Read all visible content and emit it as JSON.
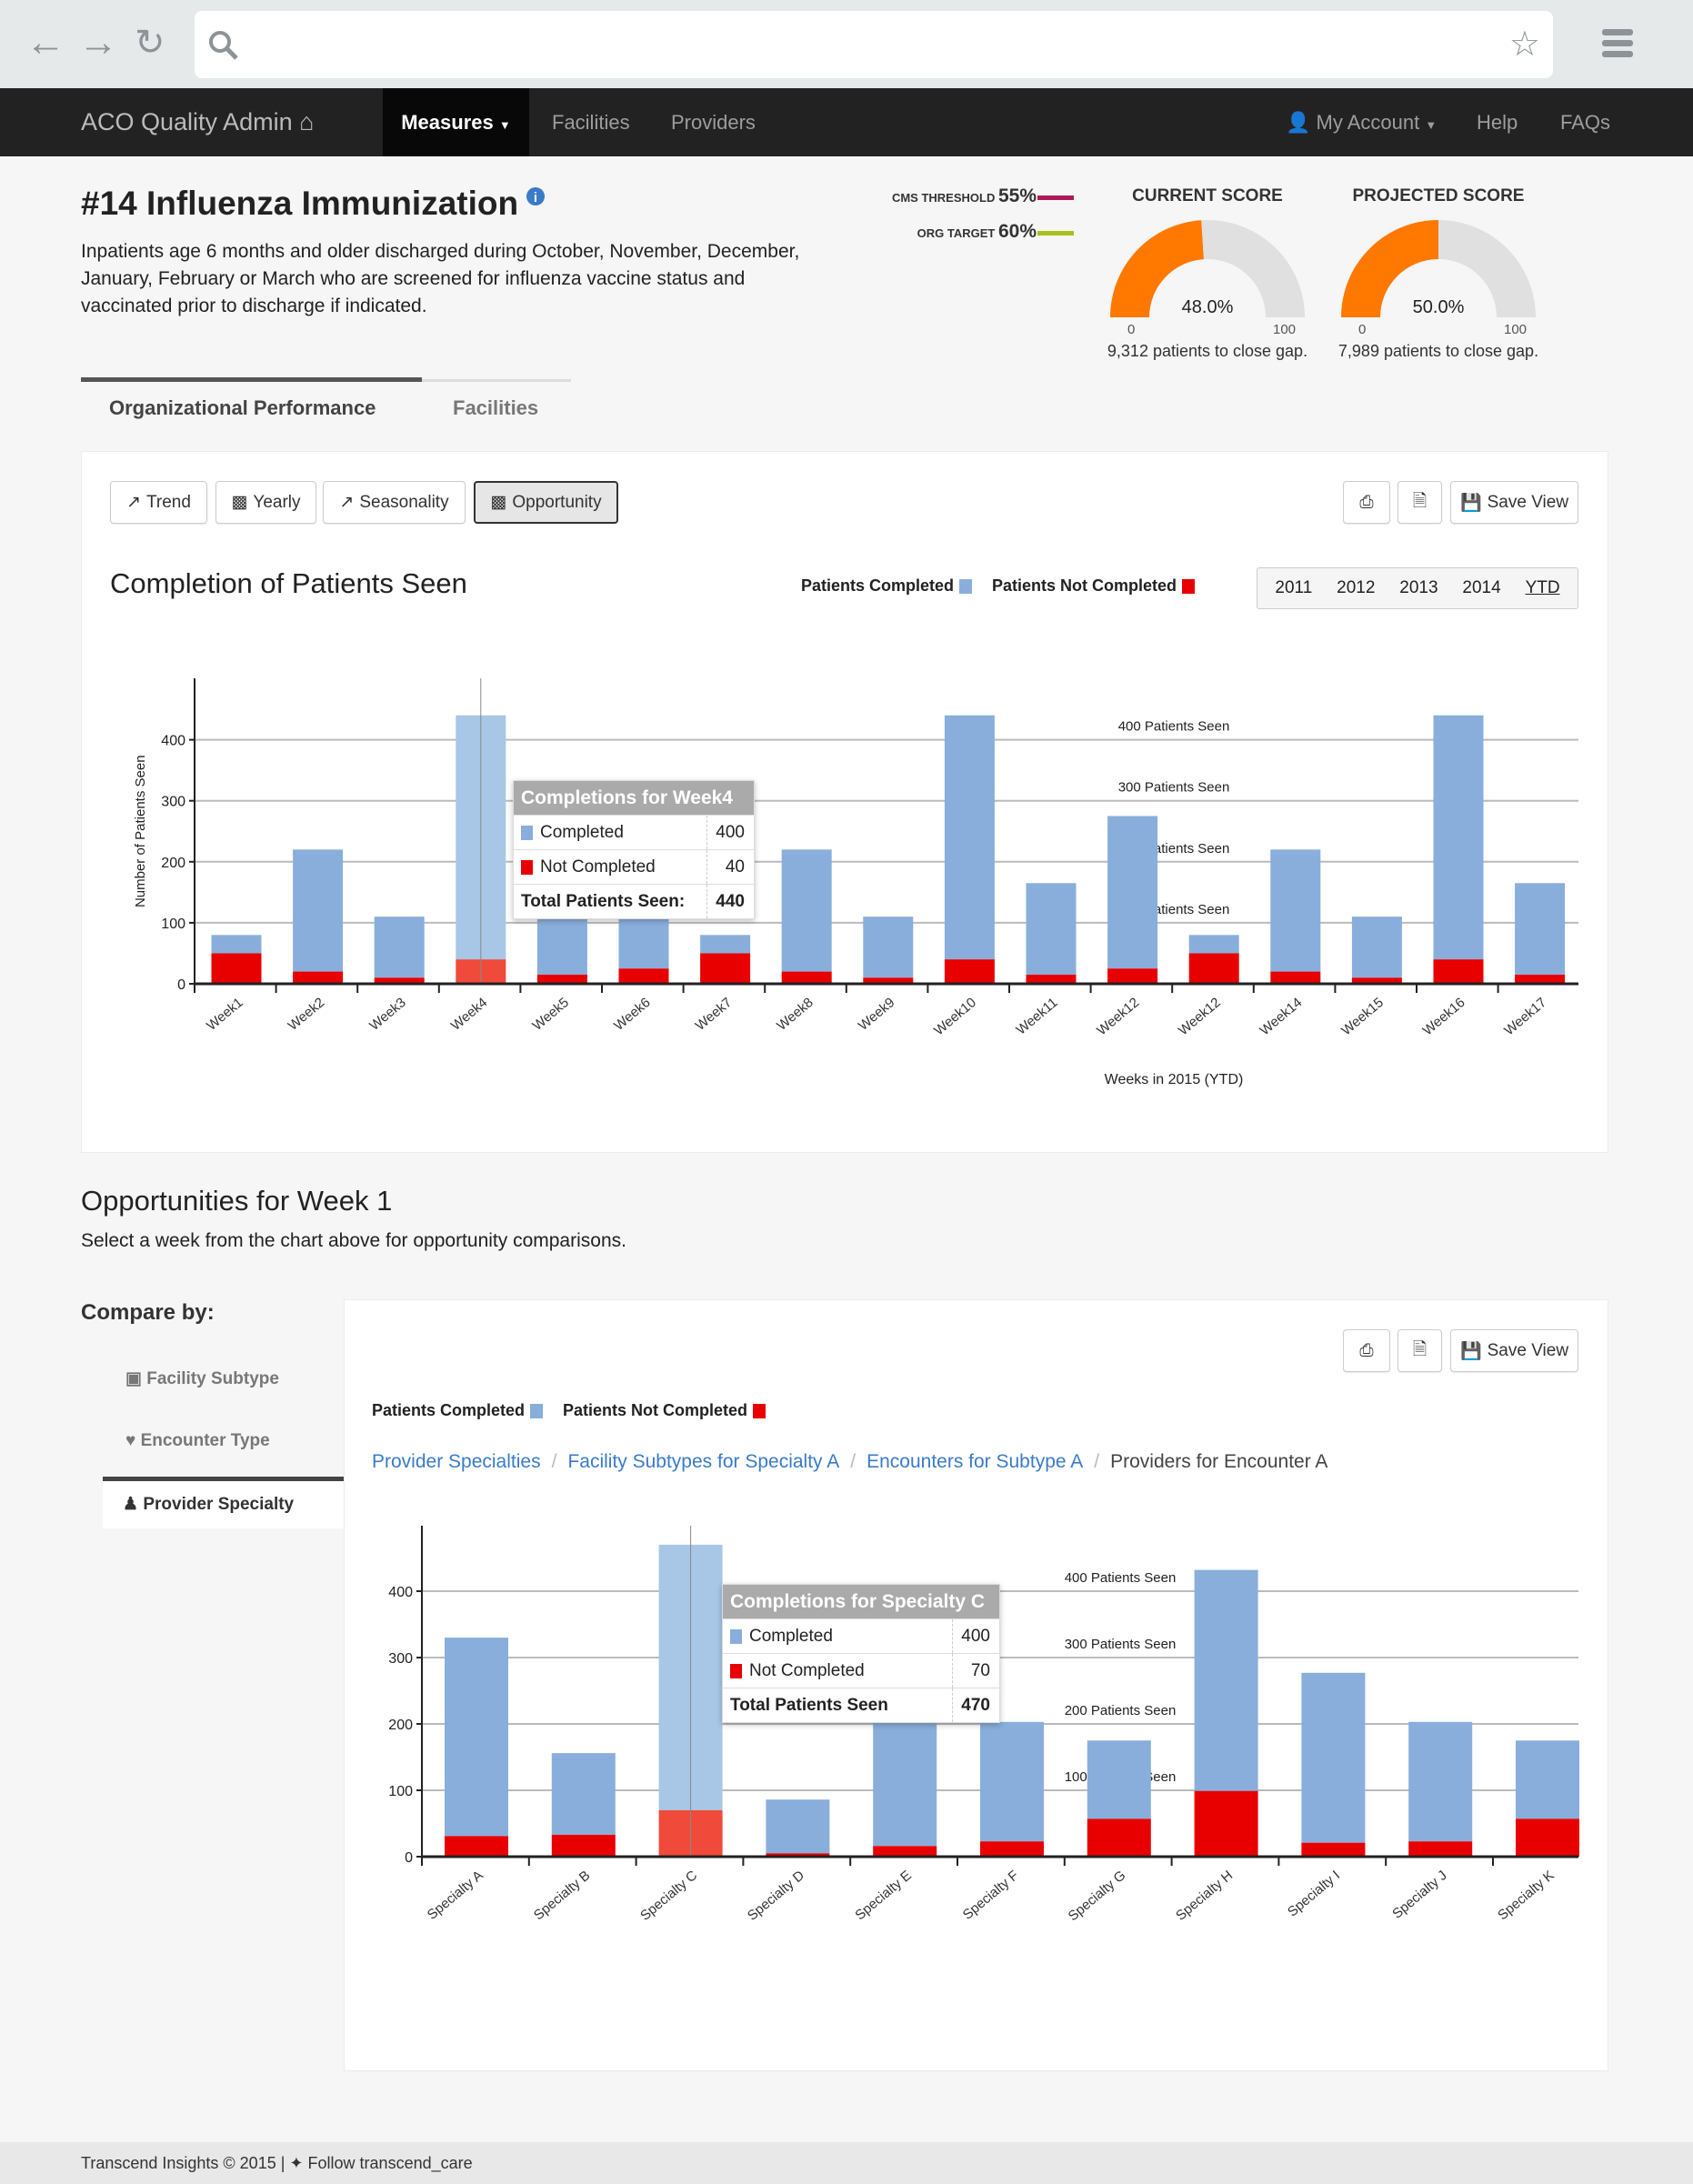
{
  "browser": {
    "url": "",
    "icons": [
      "back-arrow-icon",
      "forward-arrow-icon",
      "reload-icon",
      "search-icon",
      "star-icon",
      "menu-icon"
    ]
  },
  "navbar": {
    "brand": "ACO Quality Admin",
    "items": [
      {
        "label": "Measures",
        "active": true
      },
      {
        "label": "Facilities"
      },
      {
        "label": "Providers"
      }
    ],
    "right_items": [
      {
        "label": "My Account"
      },
      {
        "label": "Help"
      },
      {
        "label": "FAQs"
      }
    ]
  },
  "measure": {
    "title": "#14 Influenza Immunization",
    "description": "Inpatients age 6 months and older discharged during October, November, December, January, February or March who are screened for influenza vaccine status and vaccinated prior to discharge if indicated."
  },
  "thresholds": [
    {
      "label": "CMS THRESHOLD",
      "value": "55%",
      "color": "#b0185a"
    },
    {
      "label": "ORG TARGET",
      "value": "60%",
      "color": "#a9c21b"
    }
  ],
  "scores": [
    {
      "label": "CURRENT SCORE",
      "value": 48.0,
      "display": "48.0%",
      "min": "0",
      "max": "100",
      "gap_text": "9,312 patients to close gap.",
      "color": "#ff7800"
    },
    {
      "label": "PROJECTED SCORE",
      "value": 50.0,
      "display": "50.0%",
      "min": "0",
      "max": "100",
      "gap_text": "7,989 patients to close gap.",
      "color": "#ff7800"
    }
  ],
  "tabs": [
    {
      "label": "Organizational Performance",
      "active": true
    },
    {
      "label": "Facilities"
    }
  ],
  "toolbar": {
    "views": [
      {
        "label": "Trend"
      },
      {
        "label": "Yearly"
      },
      {
        "label": "Seasonality"
      },
      {
        "label": "Opportunity",
        "active": true
      }
    ],
    "save_label": "Save View"
  },
  "years": {
    "options": [
      "2011",
      "2012",
      "2013",
      "2014",
      "YTD"
    ],
    "selected": "YTD"
  },
  "legend": {
    "completed": "Patients Completed",
    "not_completed": "Patients Not Completed",
    "completed_color": "#89aedc",
    "not_completed_color": "#e80000"
  },
  "opportunities": {
    "title": "Opportunities for Week 1",
    "subtitle": "Select a week from the chart above for opportunity comparisons.",
    "compare_label": "Compare by:",
    "compare_items": [
      {
        "label": "Facility Subtype"
      },
      {
        "label": "Encounter Type"
      },
      {
        "label": "Provider Specialty",
        "active": true
      }
    ],
    "breadcrumbs": [
      "Provider Specialties",
      "Facility Subtypes for Specialty A",
      "Encounters for Subtype A",
      "Providers for Encounter A"
    ]
  },
  "chart_data": [
    {
      "type": "bar",
      "stacked": true,
      "title": "Completion of Patients Seen",
      "xlabel": "Weeks in 2015 (YTD)",
      "ylabel": "Number of Patients Seen",
      "ylim": [
        0,
        500
      ],
      "yticks": [
        "0",
        "100",
        "200",
        "300",
        "400"
      ],
      "grid": true,
      "legend_position": "top-right",
      "categories": [
        "Week1",
        "Week2",
        "Week3",
        "Week4",
        "Week5",
        "Week6",
        "Week7",
        "Week8",
        "Week9",
        "Week10",
        "Week11",
        "Week12",
        "Week12",
        "Week14",
        "Week15",
        "Week16",
        "Week17"
      ],
      "series": [
        {
          "name": "Patients Completed",
          "color": "#89aedc",
          "values": [
            30,
            200,
            100,
            400,
            150,
            250,
            30,
            200,
            100,
            400,
            150,
            250,
            30,
            200,
            100,
            400,
            150
          ]
        },
        {
          "name": "Patients Not Completed",
          "color": "#e80000",
          "values": [
            50,
            20,
            10,
            40,
            15,
            25,
            50,
            20,
            10,
            40,
            15,
            25,
            50,
            20,
            10,
            40,
            15
          ]
        }
      ],
      "reference_lines": [
        {
          "value": 400,
          "label": "400 Patients Seen"
        },
        {
          "value": 300,
          "label": "300 Patients Seen"
        },
        {
          "value": 200,
          "label": "200 Patients Seen"
        },
        {
          "value": 100,
          "label": "100 Patients Seen"
        }
      ],
      "highlighted": "Week4",
      "tooltip": {
        "title": "Completions for Week4",
        "completed_label": "Completed",
        "completed": "400",
        "not_completed_label": "Not Completed",
        "not_completed": "40",
        "total_label": "Total Patients Seen:",
        "total": "440"
      }
    },
    {
      "type": "bar",
      "stacked": true,
      "ylim": [
        0,
        500
      ],
      "yticks": [
        "0",
        "100",
        "200",
        "300",
        "400"
      ],
      "grid": true,
      "categories": [
        "Specialty A",
        "Specialty B",
        "Specialty C",
        "Specialty D",
        "Specialty E",
        "Specialty F",
        "Specialty G",
        "Specialty H",
        "Specialty I",
        "Specialty J",
        "Specialty K"
      ],
      "series": [
        {
          "name": "Patients Completed",
          "color": "#89aedc",
          "values": [
            299,
            123,
            400,
            81,
            211,
            180,
            118,
            333,
            256,
            180,
            118
          ]
        },
        {
          "name": "Patients Not Completed",
          "color": "#e80000",
          "values": [
            31,
            33,
            70,
            5,
            16,
            23,
            57,
            99,
            21,
            23,
            57
          ]
        }
      ],
      "reference_lines": [
        {
          "value": 400,
          "label": "400 Patients Seen"
        },
        {
          "value": 300,
          "label": "300 Patients Seen"
        },
        {
          "value": 200,
          "label": "200 Patients Seen"
        },
        {
          "value": 100,
          "label": "100 Patients Seen"
        }
      ],
      "highlighted": "Specialty C",
      "tooltip": {
        "title": "Completions for Specialty C",
        "completed_label": "Completed",
        "completed": "400",
        "not_completed_label": "Not Completed",
        "not_completed": "70",
        "total_label": "Total Patients Seen",
        "total": "470"
      }
    }
  ],
  "footer": {
    "copyright": "Transcend Insights © 2015 |",
    "follow": "Follow transcend_care"
  }
}
